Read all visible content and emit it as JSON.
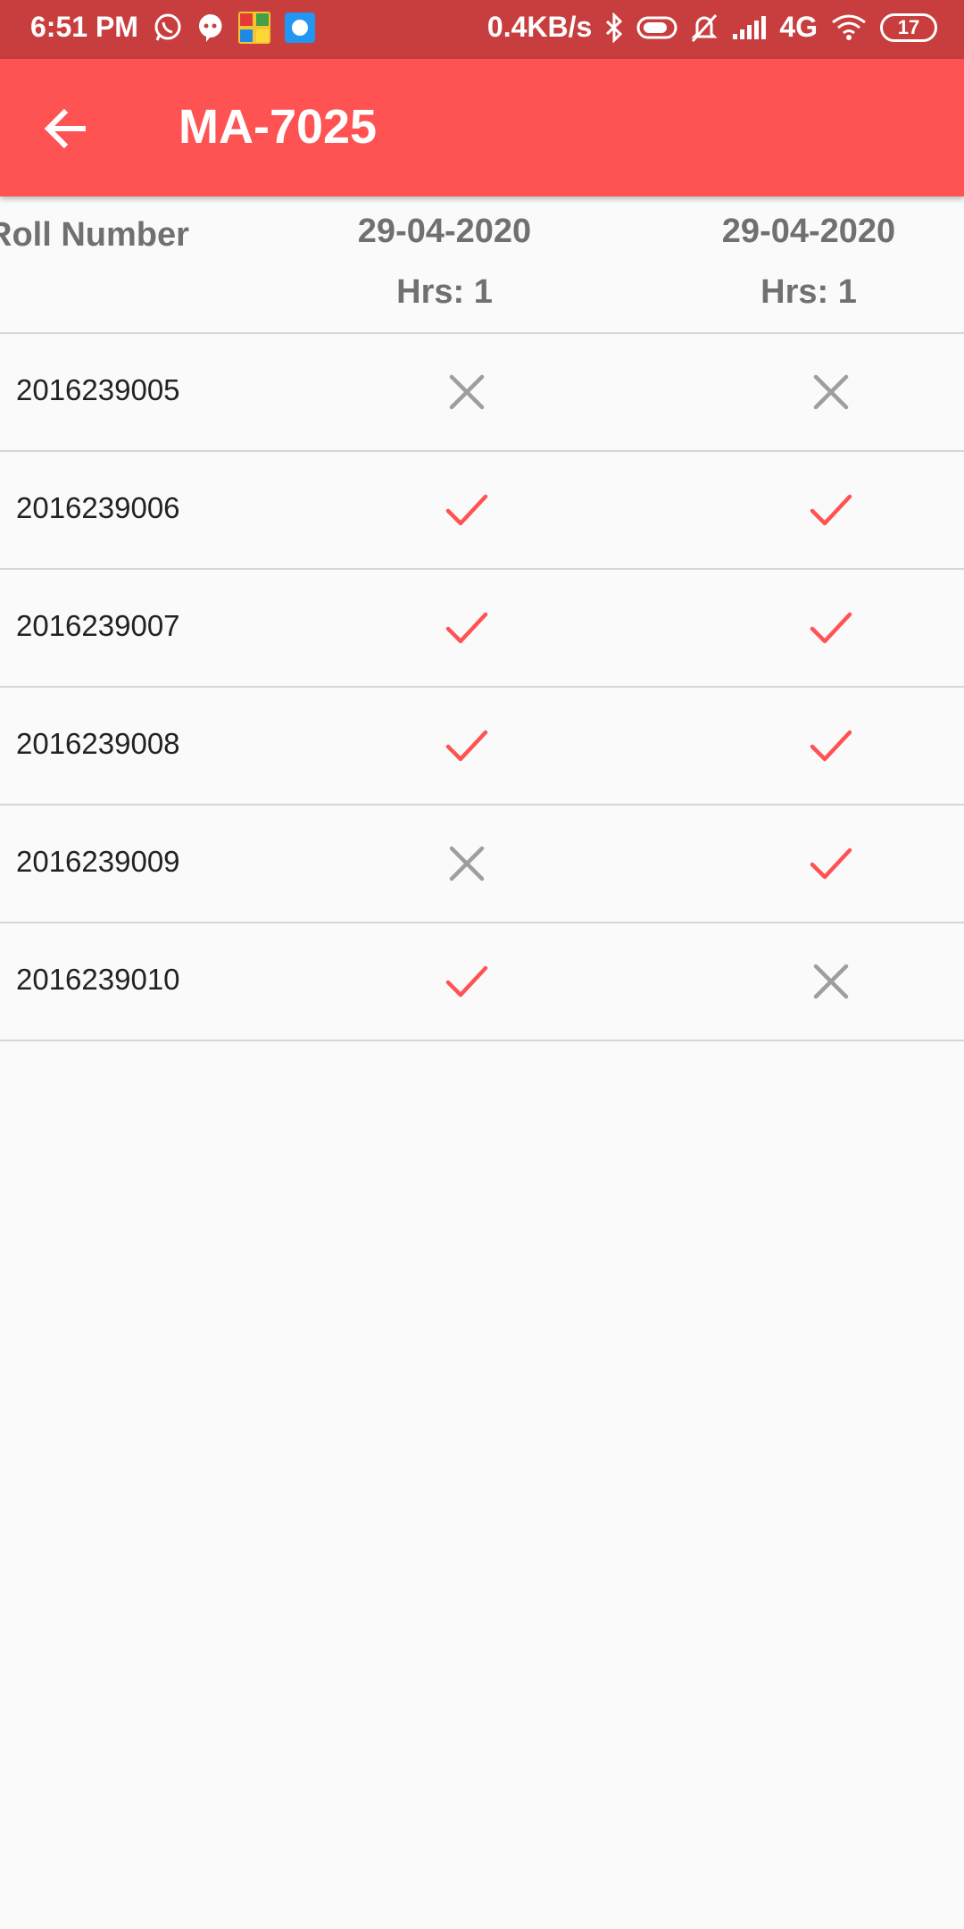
{
  "status_bar": {
    "time": "6:51 PM",
    "net_speed": "0.4KB/s",
    "network": "4G",
    "battery": "17"
  },
  "app_bar": {
    "title": "MA-7025"
  },
  "table": {
    "roll_header": "Roll Number",
    "columns": [
      {
        "date": "29-04-2020",
        "hours": "Hrs: 1"
      },
      {
        "date": "29-04-2020",
        "hours": "Hrs: 1"
      }
    ],
    "rows": [
      {
        "roll": "2016239005",
        "attendance": [
          "absent",
          "absent"
        ]
      },
      {
        "roll": "2016239006",
        "attendance": [
          "present",
          "present"
        ]
      },
      {
        "roll": "2016239007",
        "attendance": [
          "present",
          "present"
        ]
      },
      {
        "roll": "2016239008",
        "attendance": [
          "present",
          "present"
        ]
      },
      {
        "roll": "2016239009",
        "attendance": [
          "absent",
          "present"
        ]
      },
      {
        "roll": "2016239010",
        "attendance": [
          "present",
          "absent"
        ]
      }
    ]
  },
  "colors": {
    "status_bar": "#c83e3e",
    "app_bar": "#ff5252",
    "present_check": "#ff5252",
    "absent_cross": "#9e9e9e"
  },
  "icons": {
    "present": "check-icon",
    "absent": "close-icon"
  }
}
